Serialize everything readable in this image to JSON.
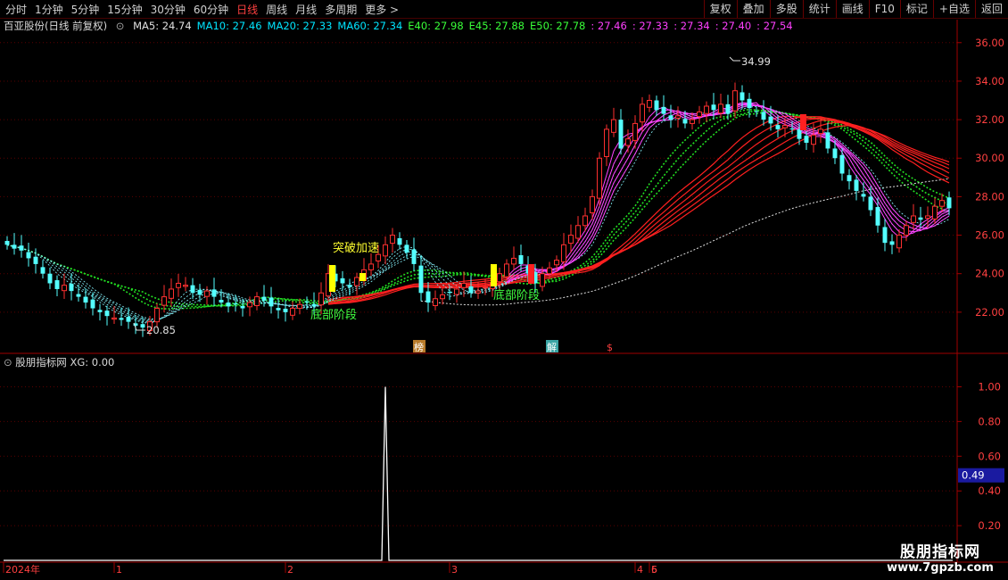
{
  "toolbar": {
    "periods": [
      "分时",
      "1分钟",
      "5分钟",
      "15分钟",
      "30分钟",
      "60分钟",
      "日线",
      "周线",
      "月线",
      "多周期",
      "更多 >"
    ],
    "active": "日线",
    "right": [
      "复权",
      "叠加",
      "多股",
      "统计",
      "画线",
      "F10",
      "标记",
      "+自选",
      "返回"
    ]
  },
  "legend": {
    "stock": "百亚股份(日线 前复权)",
    "items": [
      {
        "text": "MA5: 24.74",
        "color": "#e0e0e0"
      },
      {
        "text": "MA10: 27.46",
        "color": "#00e5ff"
      },
      {
        "text": "MA20: 27.33",
        "color": "#00e5ff"
      },
      {
        "text": "MA60: 27.34",
        "color": "#00e5ff"
      },
      {
        "text": "E40: 27.98",
        "color": "#39ff39"
      },
      {
        "text": "E45: 27.88",
        "color": "#39ff39"
      },
      {
        "text": "E50: 27.78",
        "color": "#39ff39"
      },
      {
        "text": ": 27.46",
        "color": "#ff40ff"
      },
      {
        "text": ": 27.33",
        "color": "#ff40ff"
      },
      {
        "text": ": 27.34",
        "color": "#ff40ff"
      },
      {
        "text": ": 27.40",
        "color": "#ff40ff"
      },
      {
        "text": ": 27.54",
        "color": "#ff40ff"
      }
    ]
  },
  "indicator": {
    "title": "股朋指标网 XG: 0.00",
    "current": "0.49"
  },
  "annotations": {
    "high": "34.99",
    "low": "20.85",
    "breakout": "突破加速",
    "bottom1": "底部阶段",
    "bottom2": "底部阶段",
    "marker_bang": "榜",
    "marker_jie": "解",
    "marker_dollar": "$"
  },
  "watermark": {
    "line1": "股朋指标网",
    "line2": "www.7gpzb.com"
  },
  "chart_data": [
    {
      "type": "candlestick",
      "title": "百亚股份(日线 前复权)",
      "ylim": [
        20,
        36.5
      ],
      "yticks": [
        22,
        24,
        26,
        28,
        30,
        32,
        34,
        36
      ],
      "ytick_labels": [
        "22.00",
        "24.00",
        "26.00",
        "28.00",
        "30.00",
        "32.00",
        "34.00",
        "36.00"
      ],
      "x_labels": [
        "2024年",
        "1",
        "2",
        "3",
        "4",
        "5",
        "6"
      ],
      "close": [
        25.5,
        25.3,
        25.2,
        24.8,
        24.5,
        24.0,
        23.5,
        23.2,
        23.4,
        23.1,
        22.8,
        22.5,
        22.2,
        22.0,
        21.8,
        21.7,
        21.6,
        21.5,
        21.3,
        21.2,
        21.5,
        22.2,
        22.8,
        23.2,
        23.5,
        23.4,
        23.0,
        22.9,
        23.1,
        22.8,
        22.5,
        22.3,
        22.4,
        22.2,
        22.5,
        22.8,
        22.6,
        22.3,
        22.1,
        22.0,
        22.2,
        22.4,
        22.5,
        22.3,
        23.0,
        24.0,
        23.6,
        23.5,
        23.3,
        23.8,
        24.2,
        24.5,
        25.0,
        25.5,
        26.0,
        25.5,
        25.1,
        24.5,
        23.0,
        22.5,
        22.7,
        22.9,
        23.0,
        23.2,
        23.5,
        23.0,
        23.1,
        23.3,
        23.5,
        24.0,
        24.5,
        24.8,
        24.5,
        24.0,
        23.5,
        24.0,
        24.3,
        24.7,
        25.5,
        26.0,
        26.5,
        27.0,
        28.0,
        30.0,
        31.5,
        32.0,
        30.5,
        31.0,
        31.8,
        32.8,
        33.0,
        32.5,
        32.3,
        32.0,
        32.2,
        31.8,
        32.0,
        32.4,
        32.7,
        32.5,
        32.8,
        32.3,
        33.5,
        33.0,
        32.6,
        32.4,
        32.0,
        31.8,
        31.5,
        31.7,
        31.5,
        31.0,
        30.8,
        31.2,
        31.5,
        30.5,
        30.0,
        29.2,
        28.8,
        28.3,
        28.0,
        27.3,
        26.5,
        25.6,
        25.5,
        26.0,
        26.5,
        27.0,
        26.8,
        27.0,
        27.5,
        27.8,
        27.4
      ],
      "ma_ribbon_last": [
        27.46,
        27.33,
        27.34,
        27.4,
        27.54
      ],
      "ema_last": {
        "E40": 27.98,
        "E45": 27.88,
        "E50": 27.78
      },
      "high_marker": 34.99,
      "low_marker": 20.85
    },
    {
      "type": "line",
      "title": "股朋指标网 XG: 0.00",
      "ylim": [
        0,
        1.1
      ],
      "yticks": [
        0.2,
        0.4,
        0.6,
        0.8,
        1.0
      ],
      "ytick_labels": [
        "0.20",
        "0.40",
        "0.60",
        "0.80",
        "1.00"
      ],
      "series": [
        {
          "name": "XG",
          "spike_index": 53,
          "spike_value": 1.0,
          "last": 0.0
        }
      ],
      "current_value": 0.49
    }
  ]
}
